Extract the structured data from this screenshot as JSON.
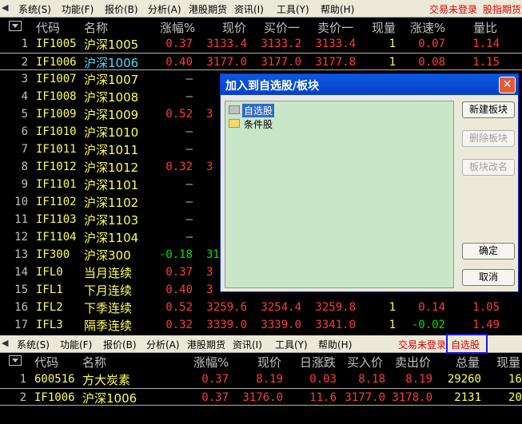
{
  "top_menu": {
    "items": [
      "系统(S)",
      "功能(F)",
      "报价(B)",
      "分析(A)",
      "港股期货",
      "资讯(I)",
      "工具(Y)",
      "帮助(H)"
    ],
    "status_login": "交易未登录",
    "status_right": "股指期货"
  },
  "top_table": {
    "headers": [
      "代码",
      "名称",
      "涨幅%",
      "现价",
      "买价一",
      "卖价一",
      "现量",
      "涨速%",
      "量比"
    ],
    "rows": [
      {
        "n": "1",
        "code": "IF1005",
        "name": "沪深1005",
        "chg": "0.37",
        "price": "3133.4",
        "bid": "3133.2",
        "ask": "3133.4",
        "vol": "1",
        "speed": "0.07",
        "ratio": "1.14",
        "speed_color": "red"
      },
      {
        "n": "2",
        "code": "IF1006",
        "name": "沪深1006",
        "chg": "0.40",
        "price": "3177.0",
        "bid": "3177.0",
        "ask": "3177.8",
        "vol": "1",
        "speed": "0.08",
        "ratio": "1.15",
        "speed_color": "red"
      },
      {
        "n": "3",
        "code": "IF1007",
        "name": "沪深1007",
        "chg": "—"
      },
      {
        "n": "4",
        "code": "IF1008",
        "name": "沪深1008",
        "chg": "—"
      },
      {
        "n": "5",
        "code": "IF1009",
        "name": "沪深1009",
        "chg": "0.52",
        "price": "3"
      },
      {
        "n": "6",
        "code": "IF1010",
        "name": "沪深1010",
        "chg": "—"
      },
      {
        "n": "7",
        "code": "IF1011",
        "name": "沪深1011",
        "chg": "—"
      },
      {
        "n": "8",
        "code": "IF1012",
        "name": "沪深1012",
        "chg": "0.32",
        "price": "3"
      },
      {
        "n": "9",
        "code": "IF1101",
        "name": "沪深1101",
        "chg": "—"
      },
      {
        "n": "10",
        "code": "IF1102",
        "name": "沪深1102",
        "chg": "—"
      },
      {
        "n": "11",
        "code": "IF1103",
        "name": "沪深1103",
        "chg": "—"
      },
      {
        "n": "12",
        "code": "IF1104",
        "name": "沪深1104",
        "chg": "—"
      },
      {
        "n": "13",
        "code": "IF300",
        "name": "沪深300",
        "chg": "-0.18",
        "price": "31",
        "chg_color": "green"
      },
      {
        "n": "14",
        "code": "IFL0",
        "name": "当月连续",
        "chg": "0.37",
        "price": "3"
      },
      {
        "n": "15",
        "code": "IFL1",
        "name": "下月连续",
        "chg": "0.40",
        "price": "3"
      },
      {
        "n": "16",
        "code": "IFL2",
        "name": "下季连续",
        "chg": "0.52",
        "price": "3259.6",
        "bid": "3254.4",
        "ask": "3259.8",
        "vol": "1",
        "speed": "0.14",
        "ratio": "1.05",
        "speed_color": "red"
      },
      {
        "n": "17",
        "code": "IFL3",
        "name": "隔季连续",
        "chg": "0.32",
        "price": "3339.0",
        "bid": "3339.0",
        "ask": "3341.0",
        "vol": "1",
        "speed": "-0.02",
        "ratio": "1.49",
        "speed_color": "green"
      }
    ]
  },
  "dialog": {
    "title": "加入到自选股/板块",
    "tree_items": [
      "自选股",
      "条件股"
    ],
    "buttons": {
      "new": "新建板块",
      "delete": "删除板块",
      "rename": "板块改名",
      "ok": "确定",
      "cancel": "取消"
    }
  },
  "bottom_menu": {
    "items": [
      "系统(S)",
      "功能(F)",
      "报价(B)",
      "分析(A)",
      "港股期货",
      "资讯(I)",
      "工具(Y)",
      "帮助(H)"
    ],
    "status_login": "交易未登录",
    "status_right": "自选股"
  },
  "bottom_table": {
    "headers": [
      "代码",
      "名称",
      "涨幅%",
      "现价",
      "日涨跌",
      "买入价",
      "卖出价",
      "总量",
      "现量"
    ],
    "rows": [
      {
        "n": "1",
        "code": "600516",
        "name": "方大炭素",
        "chg": "0.37",
        "price": "8.19",
        "diff": "0.03",
        "bid": "8.18",
        "ask": "8.19",
        "total": "29260",
        "vol": "16"
      },
      {
        "n": "2",
        "code": "IF1006",
        "name": "沪深1006",
        "chg": "0.37",
        "price": "3176.0",
        "diff": "11.6",
        "bid": "3177.0",
        "ask": "3178.0",
        "total": "2131",
        "vol": "20"
      }
    ]
  }
}
